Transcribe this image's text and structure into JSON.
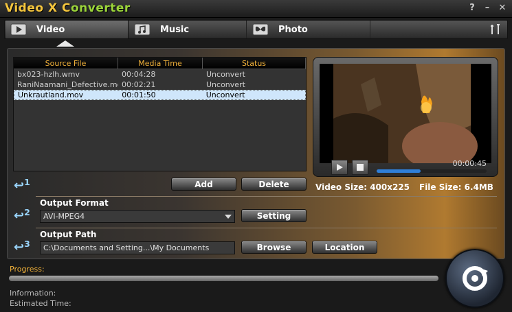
{
  "app": {
    "title_part1": "Video X C",
    "title_part2": "onverter",
    "window_controls": [
      "?",
      "–",
      "✕"
    ]
  },
  "tabs": [
    {
      "label": "Video",
      "icon": "play-icon",
      "active": true
    },
    {
      "label": "Music",
      "icon": "music-note-icon",
      "active": false
    },
    {
      "label": "Photo",
      "icon": "butterfly-icon",
      "active": false
    }
  ],
  "file_table": {
    "headers": [
      "Source File",
      "Media Time",
      "Status"
    ],
    "rows": [
      {
        "file": "bx023-hzlh.wmv",
        "time": "00:04:28",
        "status": "Unconvert",
        "selected": false
      },
      {
        "file": "RaniNaamani_Defective.mov",
        "time": "00:02:21",
        "status": "Unconvert",
        "selected": false
      },
      {
        "file": "Unkrautland.mov",
        "time": "00:01:50",
        "status": "Unconvert",
        "selected": true
      }
    ]
  },
  "preview": {
    "time": "00:00:45",
    "video_size": "Video Size: 400x225",
    "file_size": "File Size: 6.4MB",
    "seek_fraction": 0.4
  },
  "step1": {
    "number": "1",
    "add_label": "Add",
    "delete_label": "Delete"
  },
  "step2": {
    "number": "2",
    "label": "Output Format",
    "value": "AVI-MPEG4",
    "setting_label": "Setting"
  },
  "step3": {
    "number": "3",
    "label": "Output Path",
    "value": "C:\\Documents and Setting...\\My Documents",
    "browse_label": "Browse",
    "location_label": "Location"
  },
  "bottom": {
    "progress_label": "Progress:",
    "progress_fraction": 0,
    "information_label": "Information:",
    "estimated_label": "Estimated Time:"
  },
  "colors": {
    "accent": "#f2b23a",
    "title_yellow": "#f4c53d",
    "title_green": "#9bd43a",
    "selection": "#cfe6fb",
    "progress_blue": "#2f7fd8"
  }
}
